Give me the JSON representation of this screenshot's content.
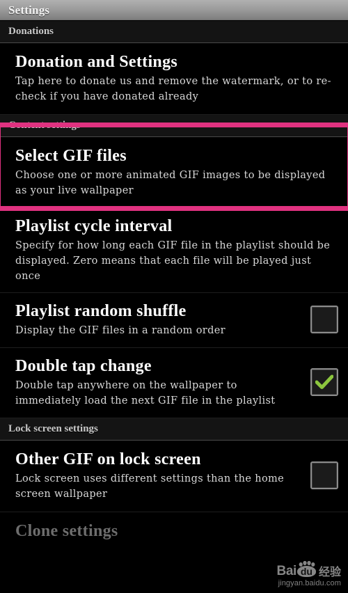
{
  "window": {
    "title": "Settings"
  },
  "colors": {
    "highlight": "#e03280",
    "checkmark": "#8cc63e",
    "titlebar_top": "#b0b0b0",
    "titlebar_bottom": "#7e7e7e",
    "background": "#000000",
    "section_header_bg": "#141414"
  },
  "sections": [
    {
      "header": "Donations",
      "rows": [
        {
          "title": "Donation and Settings",
          "summary": "Tap here to donate us and remove the watermark, or to re-check if you have donated already",
          "widget": "none"
        }
      ]
    },
    {
      "header": "Content settings",
      "rows": [
        {
          "title": "Select GIF files",
          "summary": "Choose one or more animated GIF images to be displayed as your live wallpaper",
          "widget": "none",
          "highlighted": true
        },
        {
          "title": "Playlist cycle interval",
          "summary": "Specify for how long each GIF file in the playlist should be displayed. Zero means that each file will be played just once",
          "widget": "none"
        },
        {
          "title": "Playlist random shuffle",
          "summary": "Display the GIF files in a random order",
          "widget": "checkbox",
          "checked": false
        },
        {
          "title": "Double tap change",
          "summary": "Double tap anywhere on the wallpaper to immediately load the next GIF file in the playlist",
          "widget": "checkbox",
          "checked": true
        }
      ]
    },
    {
      "header": "Lock screen settings",
      "rows": [
        {
          "title": "Other GIF on lock screen",
          "summary": "Lock screen uses different settings than the home screen wallpaper",
          "widget": "checkbox",
          "checked": false
        },
        {
          "title": "Clone settings",
          "summary": "",
          "widget": "none",
          "dim": true
        }
      ]
    }
  ],
  "watermark": {
    "brand_bai": "Bai",
    "brand_du": "du",
    "brand_cn": "经验",
    "url": "jingyan.baidu.com"
  }
}
